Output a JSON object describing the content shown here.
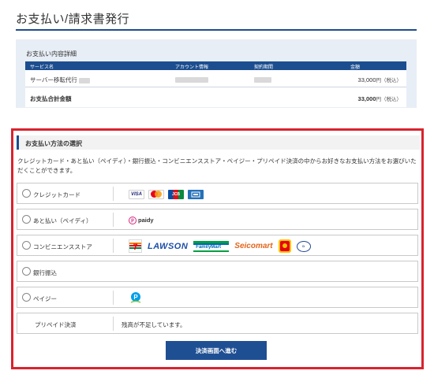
{
  "page": {
    "title": "お支払い/請求書発行"
  },
  "details": {
    "heading": "お支払い内容詳細",
    "columns": [
      "サービス名",
      "アカウント情報",
      "契約期間",
      "金額"
    ],
    "row": {
      "service": "サーバー移転代行",
      "amount": "33,000",
      "amount_unit": "円（税込）"
    },
    "total": {
      "label": "お支払合計金額",
      "amount": "33,000",
      "amount_unit": "円（税込）"
    }
  },
  "methods": {
    "heading": "お支払い方法の選択",
    "description": "クレジットカード・あと払い（ペイディ）・銀行振込・コンビニエンスストア・ペイジー・プリペイド決済の中からお好きなお支払い方法をお選びいただくことができます。",
    "options": [
      {
        "label": "クレジットカード",
        "logos": [
          "VISA",
          "Mastercard",
          "JCB",
          "American Express"
        ]
      },
      {
        "label": "あと払い（ペイディ）",
        "logos": [
          "paidy"
        ]
      },
      {
        "label": "コンビニエンスストア",
        "logos": [
          "7-Eleven",
          "LAWSON",
          "FamilyMart",
          "Seicomart",
          "MINISTOP",
          "Daily YAMAZAKI"
        ]
      },
      {
        "label": "銀行振込",
        "logos": []
      },
      {
        "label": "ペイジー",
        "logos": [
          "Pay-easy"
        ]
      }
    ],
    "paidy_text": "paidy",
    "lawson_text": "LAWSON",
    "familymart_text": "FamilyMart",
    "seicomart_text": "Seicomart",
    "visa_text": "VISA",
    "jcb_text": "JCB",
    "payeasy_text": "Pay-easy",
    "prepaid": {
      "label": "プリペイド決済",
      "message": "残高が不足しています。"
    },
    "submit_label": "決済画面へ進む"
  },
  "colors": {
    "brand_blue": "#1c4e8f",
    "highlight_red": "#d9232e"
  }
}
